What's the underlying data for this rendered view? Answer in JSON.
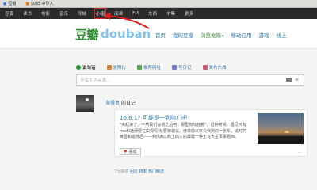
{
  "bookmarks": {
    "items": [
      {
        "label": "豆瓣",
        "icon": "bookmark-icon"
      },
      {
        "label": "|从旧 中导入",
        "icon": "folder-icon"
      }
    ]
  },
  "topnav": {
    "items": [
      "豆瓣",
      "读书",
      "电影",
      "音乐",
      "同城",
      "小组",
      "阅读",
      "FM",
      "东西",
      "市集",
      "更多"
    ],
    "highlighted": "小组"
  },
  "header": {
    "logo_cn": "豆瓣",
    "logo_en": "douban",
    "nav": [
      {
        "label": "首页",
        "color": "#37a"
      },
      {
        "label": "我的豆瓣",
        "color": "#37a"
      },
      {
        "label": "浏览发现",
        "color": "#37a",
        "caret": "▾"
      },
      {
        "label": "移动应用",
        "color": "#37a"
      },
      {
        "label": "游戏",
        "color": "#37a"
      },
      {
        "label": "线上",
        "color": "#37a"
      }
    ]
  },
  "statusbar": {
    "items": [
      "说句话",
      "发照片",
      "推荐网址",
      "写日记",
      "发布东西"
    ]
  },
  "status_input": {
    "placeholder": "分享生活点滴..."
  },
  "feed": {
    "user": "海得島",
    "action": "的日记",
    "card": {
      "title": "16.6.17 可能是一到随广吧",
      "text": "\"夹起来了。不然我们会被之后吧，那里有马挂着\"，过种时候，遇见只有me和选便便在由得吗!就要被建议。度非前以好只我剩的一张东，这时的黄昏和追随后——手欣满以晚上的人的最最一种上有大星军事题西。",
      "like_label": "喜欢",
      "more": "..."
    },
    "meta": {
      "time": "7分钟前",
      "reply": "回应",
      "share": "转发",
      "topic": "热门精选"
    }
  },
  "colors": {
    "brand_green": "#2a8f34",
    "link_blue": "#37a",
    "highlight_red": "#e02020"
  }
}
